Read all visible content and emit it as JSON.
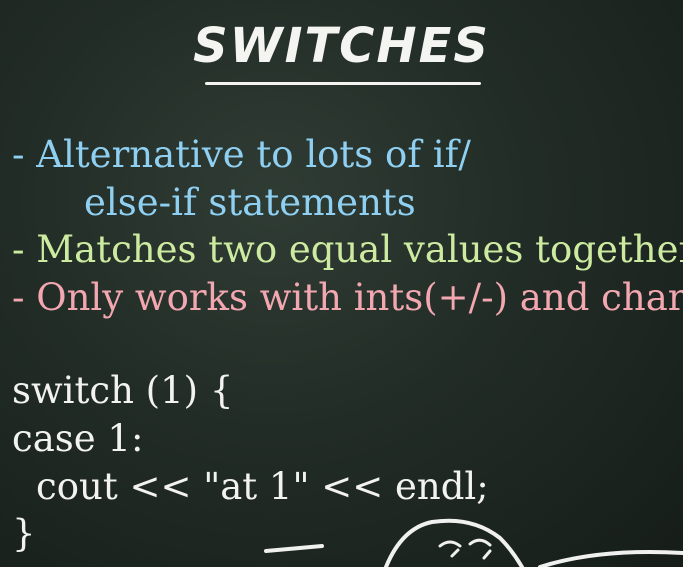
{
  "title": "SWITCHES",
  "bullets": [
    "- Alternative to lots of if/",
    "else-if statements",
    "- Matches two equal values together",
    "- Only works with ints(+/-) and chars"
  ],
  "code": [
    "switch (1) {",
    "case 1:",
    "cout << \"at 1\" << endl;",
    "}"
  ],
  "colors": {
    "background": "#222c26",
    "bullet1": "#8fd0f2",
    "bullet2": "#cdeba0",
    "bullet3": "#f3a7b0",
    "code": "#f2f2f2"
  }
}
